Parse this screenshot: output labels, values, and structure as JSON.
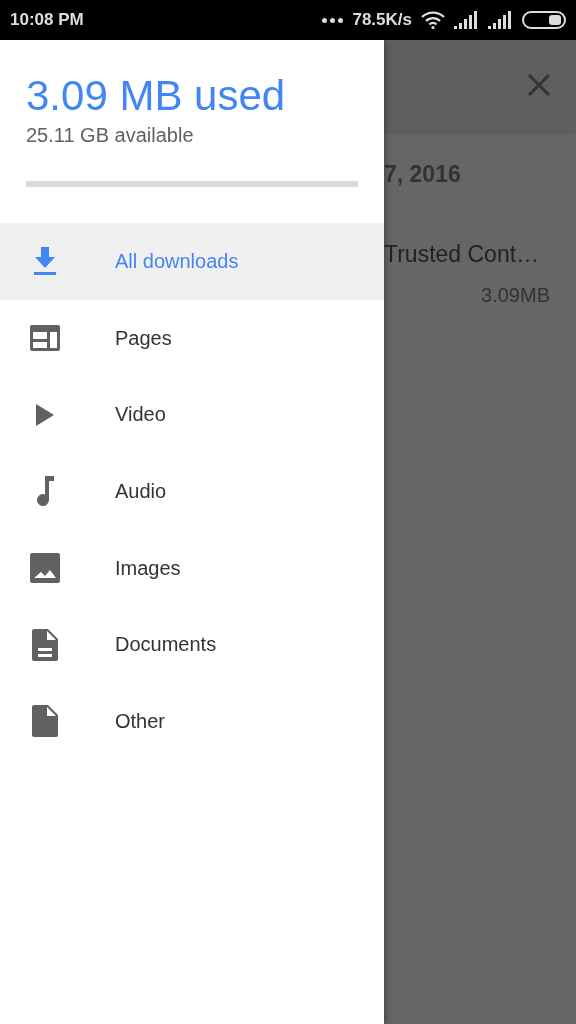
{
  "status_bar": {
    "time": "10:08 PM",
    "speed": "78.5K/s"
  },
  "drawer": {
    "used": "3.09 MB used",
    "available": "25.11 GB available",
    "storage": {
      "level": 0
    },
    "items": [
      {
        "label": "All downloads",
        "selected": true
      },
      {
        "label": "Pages",
        "selected": false
      },
      {
        "label": "Video",
        "selected": false
      },
      {
        "label": "Audio",
        "selected": false
      },
      {
        "label": "Images",
        "selected": false
      },
      {
        "label": "Documents",
        "selected": false
      },
      {
        "label": "Other",
        "selected": false
      }
    ]
  },
  "background": {
    "date": "7, 2016",
    "file_name": "Trusted Cont…",
    "file_size": "3.09MB"
  }
}
